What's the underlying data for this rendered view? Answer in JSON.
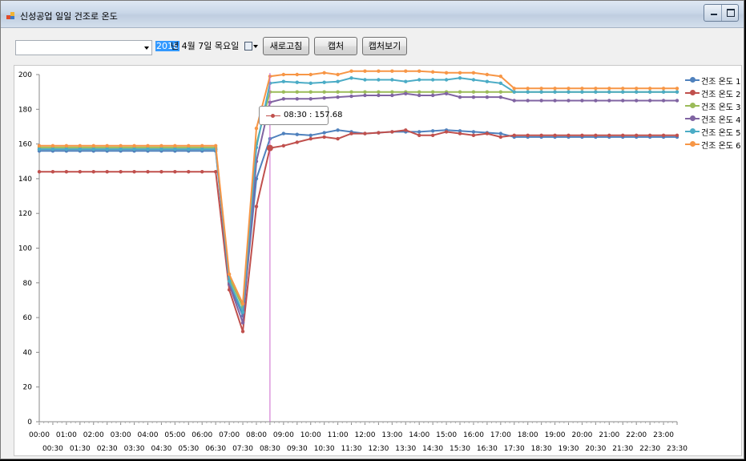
{
  "window": {
    "title": "신성공업 일일 건조로 온도"
  },
  "toolbar": {
    "combo_value": "",
    "date": {
      "year_part": "2016",
      "rest": "년  4월  7일 목요일"
    },
    "refresh_label": "새로고침",
    "capture_label": "캡처",
    "capture_view_label": "캡처보기"
  },
  "tooltip": {
    "text": "08:30 : 157.68"
  },
  "colors": {
    "window_bg": "#f0f0f0",
    "crosshair": "#cc66cc",
    "selection": "#3399ff"
  },
  "chart_data": {
    "type": "line",
    "title": "",
    "xlabel": "",
    "ylabel": "",
    "ylim": [
      0,
      200
    ],
    "yticks": [
      0,
      20,
      40,
      60,
      80,
      100,
      120,
      140,
      160,
      180,
      200
    ],
    "x_hours": [
      0,
      0.5,
      1,
      1.5,
      2,
      2.5,
      3,
      3.5,
      4,
      4.5,
      5,
      5.5,
      6,
      6.5,
      7,
      7.5,
      8,
      8.5,
      9,
      9.5,
      10,
      10.5,
      11,
      11.5,
      12,
      12.5,
      13,
      13.5,
      14,
      14.5,
      15,
      15.5,
      16,
      16.5,
      17,
      17.5,
      18,
      18.5,
      19,
      19.5,
      20,
      20.5,
      21,
      21.5,
      22,
      22.5,
      23,
      23.5
    ],
    "x_labels_row1": [
      "00:00",
      "01:00",
      "02:00",
      "03:00",
      "04:00",
      "05:00",
      "06:00",
      "07:00",
      "08:00",
      "09:00",
      "10:00",
      "11:00",
      "12:00",
      "13:00",
      "14:00",
      "15:00",
      "16:00",
      "17:00",
      "18:00",
      "19:00",
      "20:00",
      "21:00",
      "22:00",
      "23:00"
    ],
    "x_labels_row2": [
      "00:30",
      "01:30",
      "02:30",
      "03:30",
      "04:30",
      "05:30",
      "06:30",
      "07:30",
      "08:30",
      "09:30",
      "10:30",
      "11:30",
      "12:30",
      "13:30",
      "14:30",
      "15:30",
      "16:30",
      "17:30",
      "18:30",
      "19:30",
      "20:30",
      "21:30",
      "22:30",
      "23:30"
    ],
    "legend_position": "right",
    "series": [
      {
        "name": "건조 온도 1",
        "color": "#4f81bd",
        "values": [
          [
            0,
            156
          ],
          [
            6.5,
            156
          ],
          [
            7,
            80
          ],
          [
            7.5,
            61
          ],
          [
            8,
            140
          ],
          [
            8.5,
            163
          ],
          [
            9,
            166
          ],
          [
            10,
            165
          ],
          [
            11,
            168
          ],
          [
            12,
            166
          ],
          [
            13,
            167
          ],
          [
            14,
            167
          ],
          [
            15,
            168
          ],
          [
            16,
            167
          ],
          [
            17,
            166
          ],
          [
            17.5,
            164
          ],
          [
            18,
            164
          ],
          [
            23.5,
            164
          ]
        ]
      },
      {
        "name": "건조 온도 2",
        "color": "#c0504d",
        "values": [
          [
            0,
            144
          ],
          [
            6.5,
            144
          ],
          [
            7,
            76
          ],
          [
            7.5,
            52
          ],
          [
            8,
            124
          ],
          [
            8.5,
            157.68
          ],
          [
            9,
            159
          ],
          [
            9.5,
            161
          ],
          [
            10,
            163
          ],
          [
            10.5,
            164
          ],
          [
            11,
            163
          ],
          [
            11.5,
            166
          ],
          [
            12,
            166
          ],
          [
            13,
            167
          ],
          [
            13.5,
            168
          ],
          [
            14,
            165
          ],
          [
            14.5,
            165
          ],
          [
            15,
            167
          ],
          [
            16,
            165
          ],
          [
            16.5,
            166
          ],
          [
            17,
            164
          ],
          [
            17.5,
            165
          ],
          [
            18,
            165
          ],
          [
            23.5,
            165
          ]
        ]
      },
      {
        "name": "건조 온도 3",
        "color": "#9bbb59",
        "values": [
          [
            0,
            158
          ],
          [
            6.5,
            158
          ],
          [
            7,
            83
          ],
          [
            7.5,
            66
          ],
          [
            8,
            160
          ],
          [
            8.5,
            190
          ],
          [
            11,
            190
          ],
          [
            12,
            190
          ],
          [
            13,
            190
          ],
          [
            14,
            190
          ],
          [
            15,
            190
          ],
          [
            16,
            190
          ],
          [
            17,
            190
          ],
          [
            17.5,
            190
          ],
          [
            18,
            190
          ],
          [
            23.5,
            190
          ]
        ]
      },
      {
        "name": "건조 온도 4",
        "color": "#8064a2",
        "values": [
          [
            0,
            157
          ],
          [
            6.5,
            157
          ],
          [
            7,
            79
          ],
          [
            7.5,
            57
          ],
          [
            8,
            150
          ],
          [
            8.5,
            184
          ],
          [
            9,
            186
          ],
          [
            10,
            186
          ],
          [
            11,
            187
          ],
          [
            12,
            188
          ],
          [
            13,
            188
          ],
          [
            13.5,
            189
          ],
          [
            14,
            188
          ],
          [
            14.5,
            188
          ],
          [
            15,
            189
          ],
          [
            15.5,
            187
          ],
          [
            16,
            187
          ],
          [
            17,
            187
          ],
          [
            17.5,
            185
          ],
          [
            18,
            185
          ],
          [
            23.5,
            185
          ]
        ]
      },
      {
        "name": "건조 온도 5",
        "color": "#4bacc6",
        "values": [
          [
            0,
            157
          ],
          [
            6.5,
            157
          ],
          [
            7,
            81
          ],
          [
            7.5,
            63
          ],
          [
            8,
            158
          ],
          [
            8.5,
            195
          ],
          [
            9,
            196
          ],
          [
            10,
            195
          ],
          [
            11,
            196
          ],
          [
            11.5,
            198
          ],
          [
            12,
            197
          ],
          [
            13,
            197
          ],
          [
            13.5,
            196
          ],
          [
            14,
            197
          ],
          [
            15,
            197
          ],
          [
            15.5,
            198
          ],
          [
            16,
            197
          ],
          [
            16.5,
            196
          ],
          [
            17,
            195
          ],
          [
            17.5,
            190
          ],
          [
            18,
            190
          ],
          [
            23.5,
            190
          ]
        ]
      },
      {
        "name": "건조 온도 6",
        "color": "#f79646",
        "values": [
          [
            0,
            159
          ],
          [
            6.5,
            159
          ],
          [
            7,
            85
          ],
          [
            7.5,
            68
          ],
          [
            8,
            169
          ],
          [
            8.5,
            199
          ],
          [
            9,
            200
          ],
          [
            10,
            200
          ],
          [
            10.5,
            201
          ],
          [
            11,
            200
          ],
          [
            11.5,
            202
          ],
          [
            12,
            202
          ],
          [
            13,
            202
          ],
          [
            14,
            202
          ],
          [
            15,
            201
          ],
          [
            16,
            201
          ],
          [
            16.5,
            200
          ],
          [
            17,
            199
          ],
          [
            17.5,
            192
          ],
          [
            18,
            192
          ],
          [
            23.5,
            192
          ]
        ]
      }
    ],
    "crosshair_hour": 8.5
  }
}
